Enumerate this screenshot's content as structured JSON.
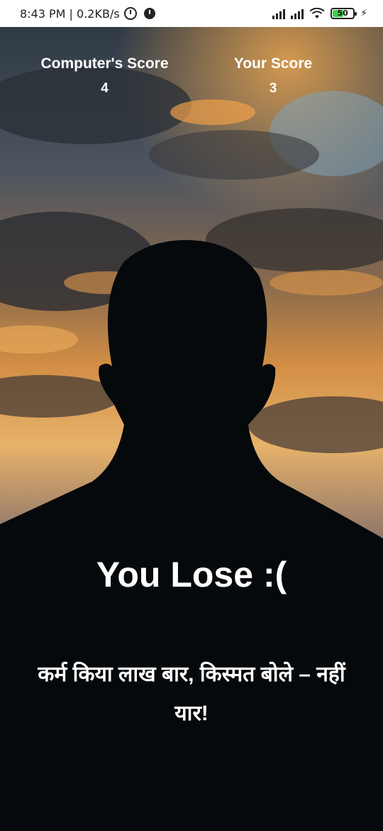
{
  "status_bar": {
    "time_speed": "8:43 PM | 0.2KB/s",
    "battery_level": "50",
    "icons": [
      "alarm-icon",
      "dnd-icon",
      "signal-icon",
      "signal-icon",
      "wifi-icon",
      "battery-icon",
      "charging-icon"
    ]
  },
  "scores": {
    "computer_label": "Computer's Score",
    "computer_value": "4",
    "player_label": "Your Score",
    "player_value": "3"
  },
  "result": {
    "title": "You Lose :(",
    "quote": "कर्म किया लाख बार, किस्मत बोले – नहीं यार!"
  },
  "colors": {
    "sky_top": "#3c4a57",
    "sunset_orange": "#e9a24a",
    "silhouette": "#05090c",
    "text": "#ffffff"
  }
}
